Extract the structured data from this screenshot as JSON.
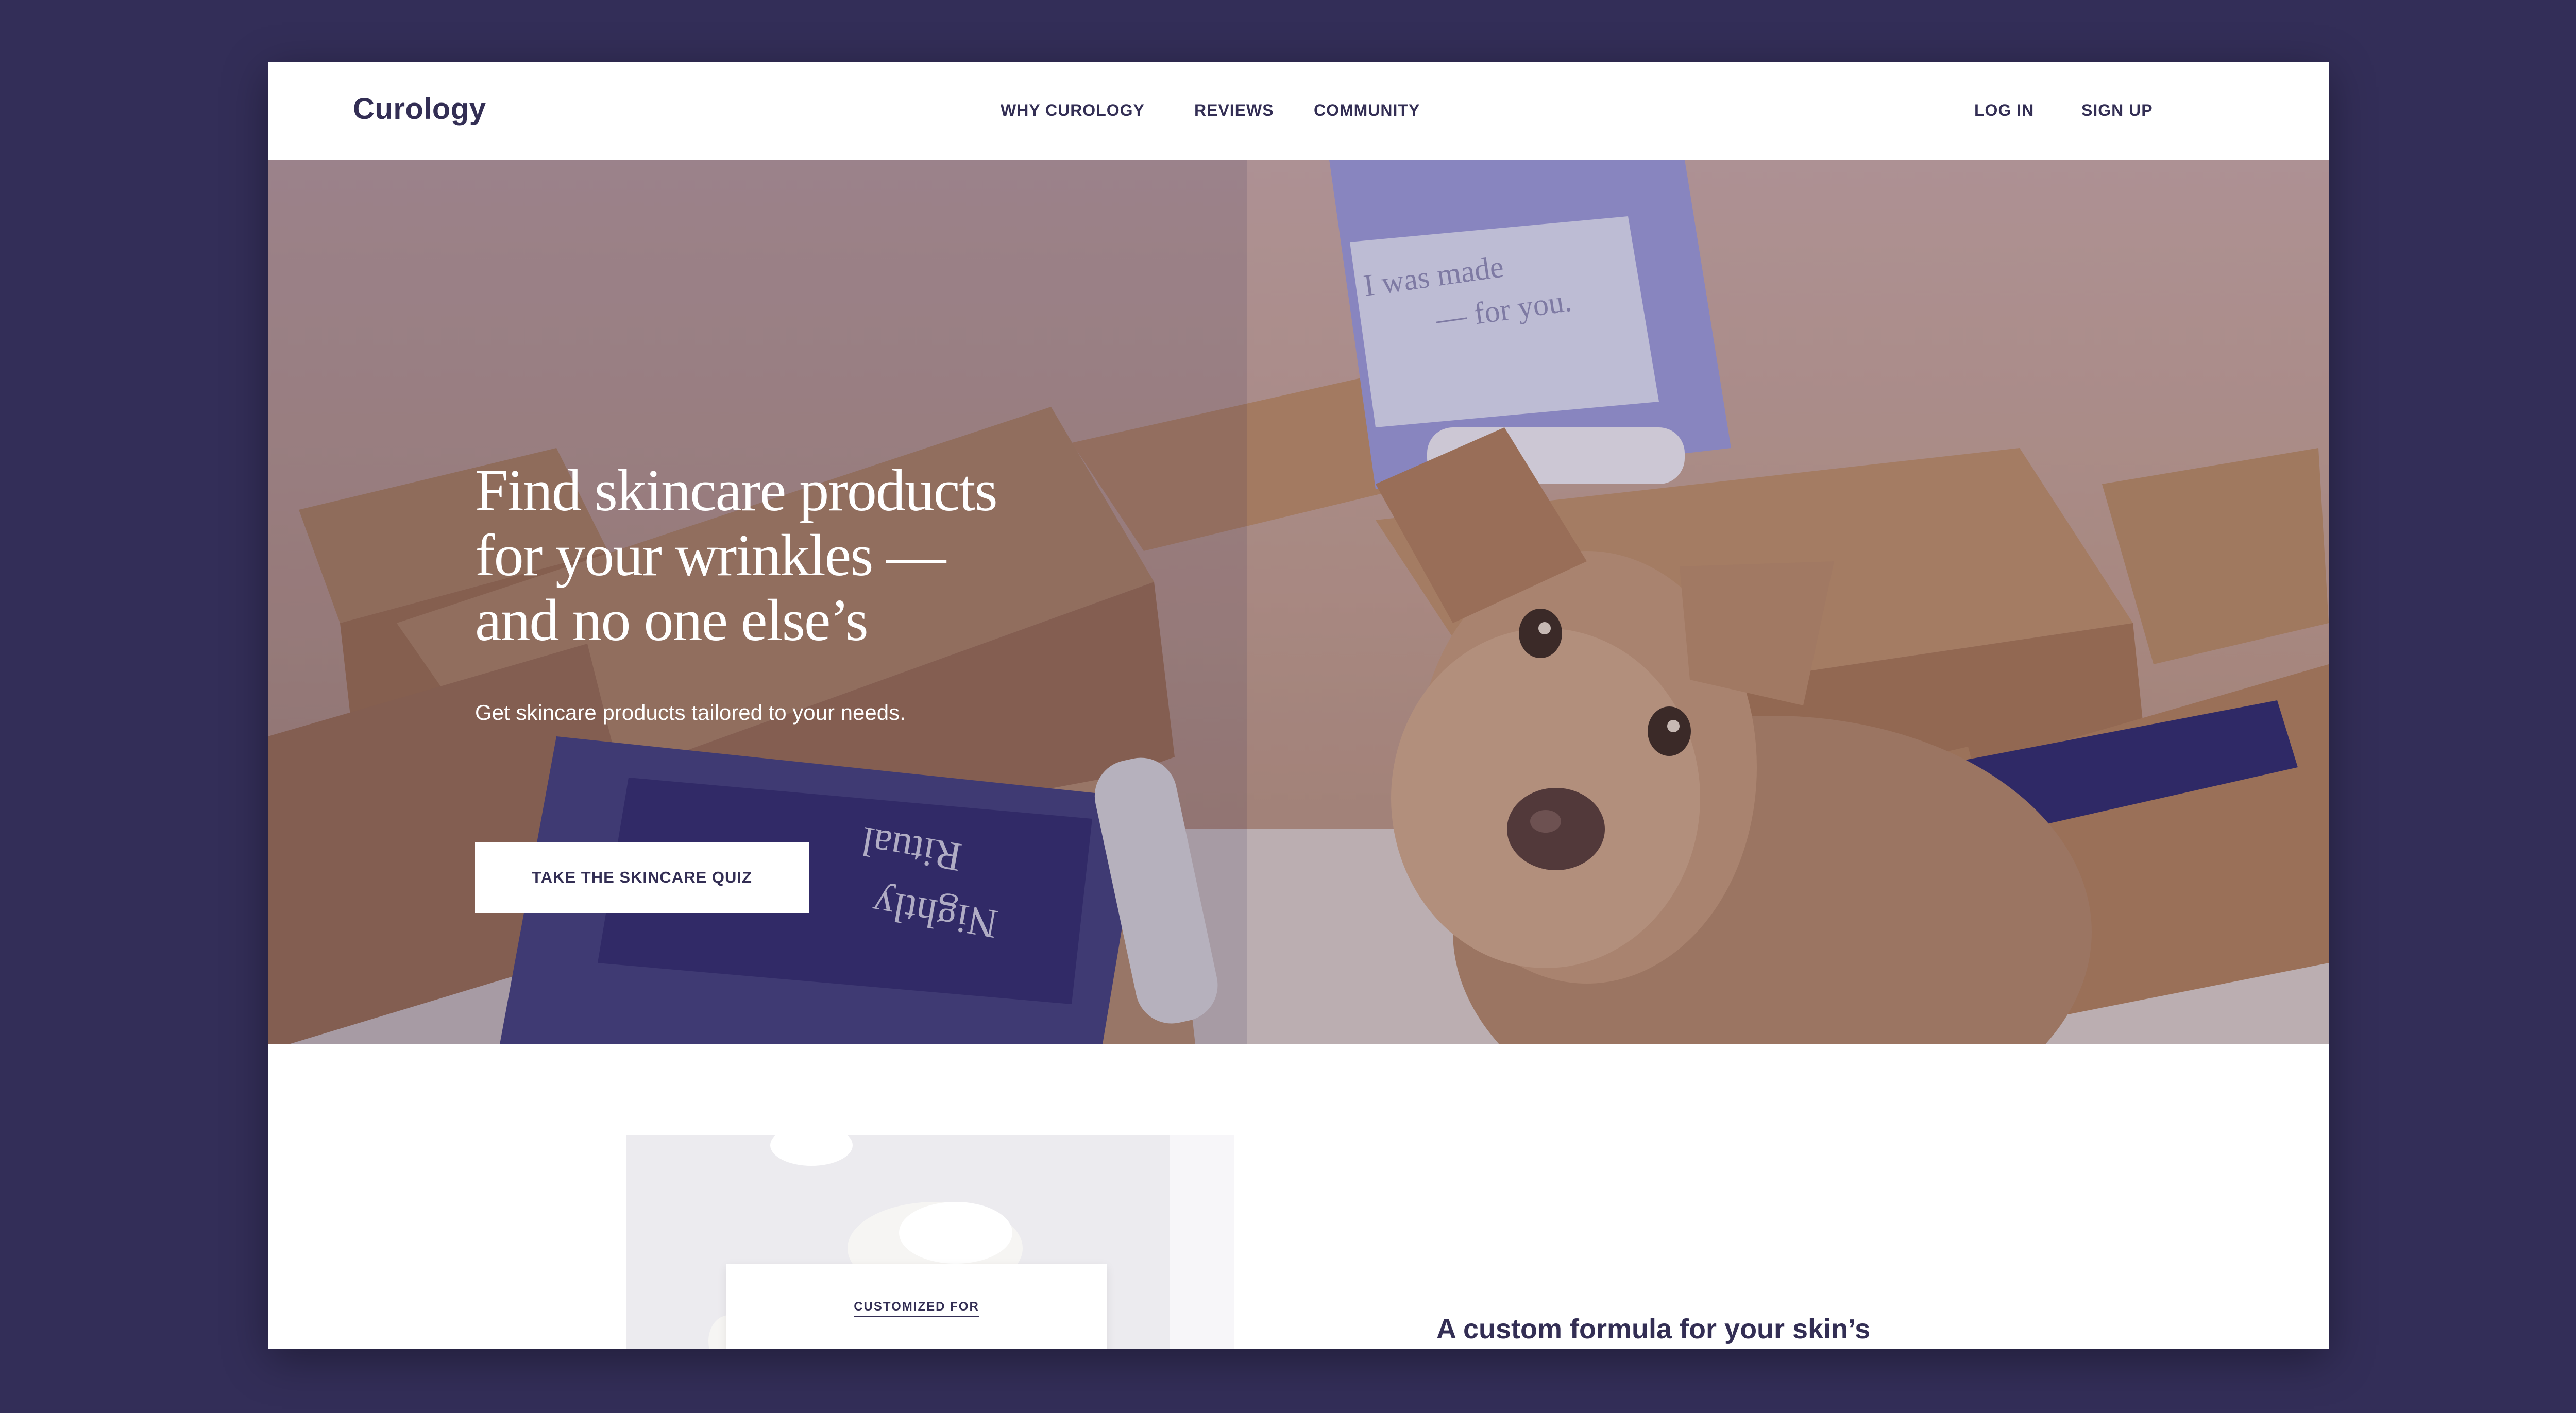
{
  "header": {
    "logo": "Curology",
    "nav": [
      "WHY CUROLOGY",
      "REVIEWS",
      "COMMUNITY"
    ],
    "login": "LOG IN",
    "signup": "SIGN UP"
  },
  "hero": {
    "title_lines": [
      "Find skincare products",
      "for your wrinkles —",
      "and no one else’s"
    ],
    "subtitle": "Get skincare products tailored to your needs.",
    "cta": "TAKE THE SKINCARE QUIZ",
    "photo_card_text": [
      "I was made",
      "— for you."
    ],
    "box_text": [
      "Nightly",
      "Ritual"
    ]
  },
  "feature": {
    "card_label": "CUSTOMIZED FOR",
    "heading": "A custom formula for your skin’s"
  },
  "colors": {
    "background": "#332e58",
    "brand_text": "#332e54",
    "white": "#ffffff"
  }
}
